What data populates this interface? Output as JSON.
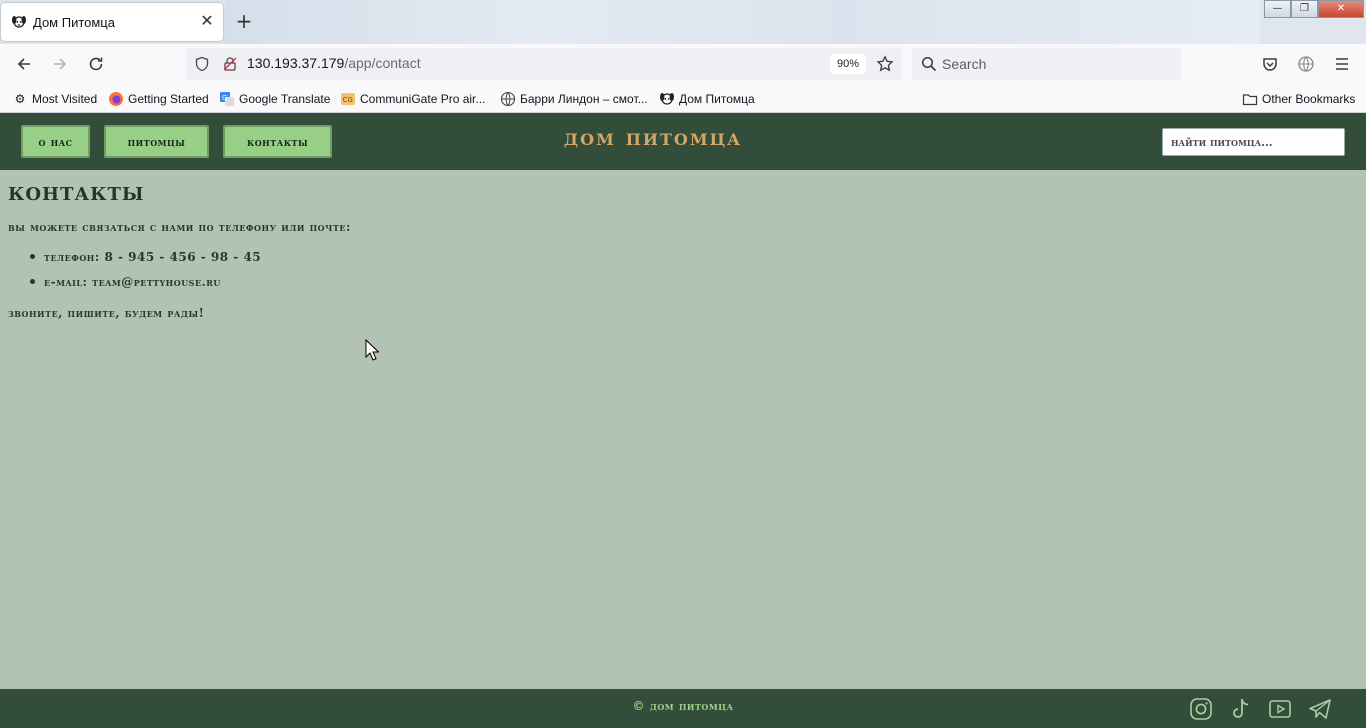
{
  "browser": {
    "tab_title": "Дом Питомца",
    "url_host": "130.193.37.179",
    "url_path": "/app/contact",
    "zoom": "90%",
    "search_placeholder": "Search",
    "bookmarks": [
      {
        "label": "Most Visited",
        "icon": "gear-icon"
      },
      {
        "label": "Getting Started",
        "icon": "firefox-icon"
      },
      {
        "label": "Google Translate",
        "icon": "translate-icon"
      },
      {
        "label": "CommuniGate Pro air...",
        "icon": "cg-icon"
      },
      {
        "label": "Барри Линдон – смот...",
        "icon": "globe-icon"
      },
      {
        "label": "Дом Питомца",
        "icon": "pet-icon"
      }
    ],
    "other_bookmarks": "Other Bookmarks"
  },
  "site": {
    "nav": [
      {
        "label": "О нас"
      },
      {
        "label": "Питомцы"
      },
      {
        "label": "Контакты"
      }
    ],
    "logo": "Дом Питомца",
    "search_placeholder": "Найти питомца..."
  },
  "contact": {
    "title": "Контакты",
    "intro": "Вы можете связаться с нами по телефону или почте:",
    "items": [
      {
        "text": "Телефон: 8 - 945 - 456 - 98 - 45"
      },
      {
        "text": "E-mail: team@pettyhouse.ru"
      }
    ],
    "closing": "Звоните, пишите, будем рады!"
  },
  "footer": {
    "copyright": "© Дом Питомца",
    "social": [
      "instagram-icon",
      "tiktok-icon",
      "youtube-icon",
      "telegram-icon"
    ]
  },
  "colors": {
    "header_bg": "#324d3a",
    "page_bg": "#b2c3b3",
    "nav_button": "#98cf86",
    "logo": "#d6a664",
    "text": "#1e3b2a"
  }
}
